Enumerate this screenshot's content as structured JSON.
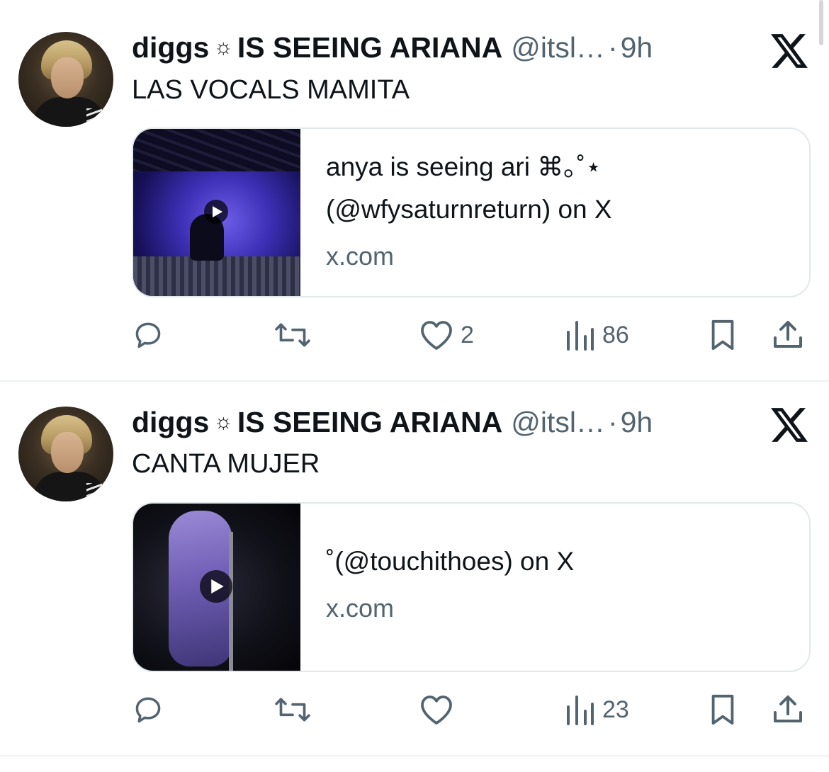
{
  "tweets": [
    {
      "display_name": "diggs",
      "name_symbol": "☼",
      "name_suffix": "IS SEEING ARIANA",
      "handle": "@itsl…",
      "separator": "·",
      "time": "9h",
      "text": "LAS VOCALS MAMITA",
      "card": {
        "title_line1": "anya is seeing ari ⌘｡˚⋆",
        "title_line2": "(@wfysaturnreturn) on X",
        "domain": "x.com"
      },
      "actions": {
        "replies": "",
        "reposts": "",
        "likes": "2",
        "views": "86"
      }
    },
    {
      "display_name": "diggs",
      "name_symbol": "☼",
      "name_suffix": "IS SEEING ARIANA",
      "handle": "@itsl…",
      "separator": "·",
      "time": "9h",
      "text": "CANTA MUJER",
      "card": {
        "title_line1": "˚(@touchithoes) on X",
        "domain": "x.com"
      },
      "actions": {
        "replies": "",
        "reposts": "",
        "likes": "",
        "views": "23"
      }
    }
  ],
  "colors": {
    "text": "#0f1419",
    "secondary": "#536471",
    "border": "#e3e8eb"
  },
  "icons": {
    "logo": "x-logo-icon",
    "reply": "reply-icon",
    "repost": "repost-icon",
    "like": "heart-icon",
    "views": "views-chart-icon",
    "bookmark": "bookmark-icon",
    "share": "share-icon",
    "play": "play-icon"
  }
}
